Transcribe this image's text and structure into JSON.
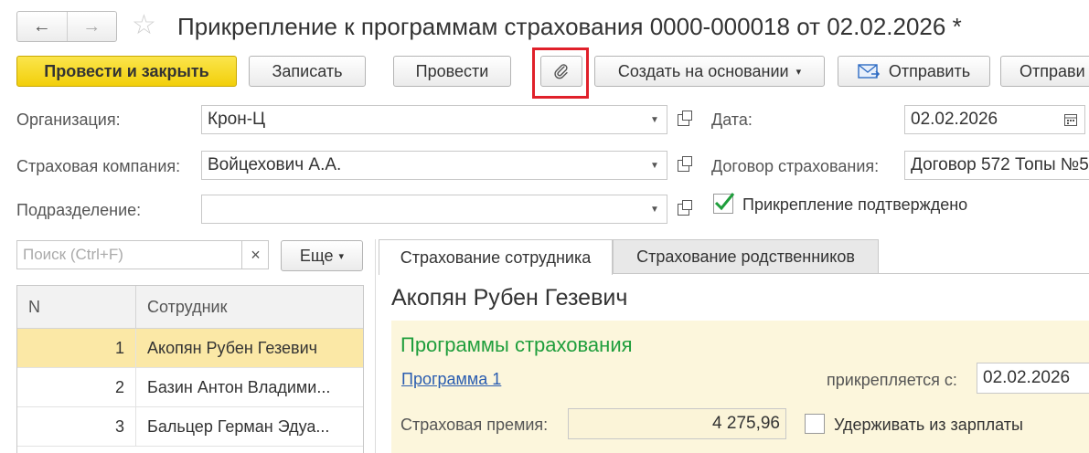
{
  "title": "Прикрепление к программам страхования 0000-000018 от 02.02.2026 *",
  "nav": {
    "back": "←",
    "forward": "→",
    "star": "☆"
  },
  "toolbar": {
    "post_close": "Провести и закрыть",
    "save": "Записать",
    "post": "Провести",
    "create_based": "Создать на основании",
    "dropdown_arrow": "▾",
    "send": "Отправить",
    "send2": "Отправи"
  },
  "form": {
    "org_label": "Организация:",
    "org_value": "Крон-Ц",
    "insurer_label": "Страховая компания:",
    "insurer_value": "Войцехович А.А.",
    "dept_label": "Подразделение:",
    "dept_value": "",
    "date_label": "Дата:",
    "date_value": "02.02.2026",
    "contract_label": "Договор страхования:",
    "contract_value": "Договор 572 Топы №5",
    "confirmed_label": "Прикрепление подтверждено",
    "confirmed_checked": true
  },
  "search": {
    "placeholder": "Поиск (Ctrl+F)",
    "clear": "×",
    "more": "Еще",
    "more_arrow": "▾"
  },
  "table": {
    "headers": {
      "n": "N",
      "employee": "Сотрудник"
    },
    "rows": [
      {
        "n": "1",
        "name": "Акопян Рубен Гезевич"
      },
      {
        "n": "2",
        "name": "Базин Антон Владими..."
      },
      {
        "n": "3",
        "name": "Бальцер Герман Эдуа..."
      }
    ]
  },
  "tabs": [
    "Страхование сотрудника",
    "Страхование родственников"
  ],
  "detail": {
    "employee_name": "Акопян Рубен Гезевич",
    "section_title": "Программы страхования",
    "program_link": "Программа 1",
    "attach_from_label": "прикрепляется с:",
    "attach_from_value": "02.02.2026",
    "premium_label": "Страховая премия:",
    "premium_value": "4 275,96",
    "deduct_label": "Удерживать из зарплаты"
  },
  "colors": {
    "primary": "#f5d320",
    "highlight_row": "#fbe8a6",
    "panel": "#fcf6dc",
    "section_title": "#1f9e3c",
    "link": "#2a5db0",
    "focus_box": "#e0202a"
  }
}
